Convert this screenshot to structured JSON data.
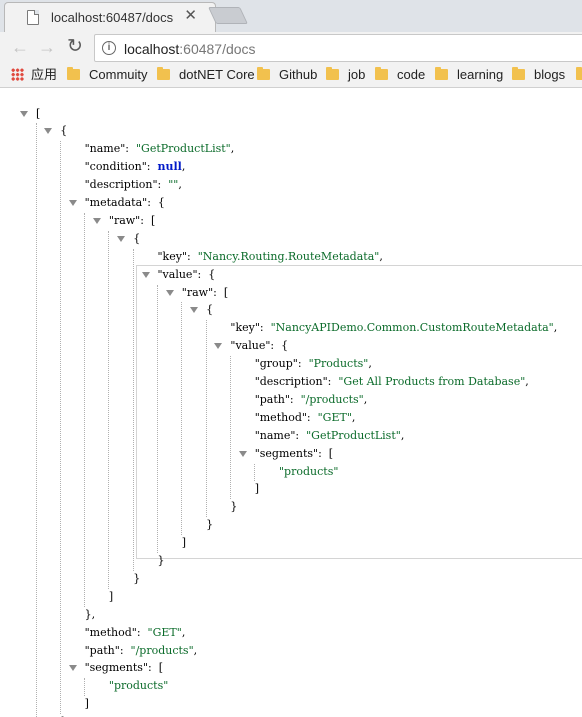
{
  "browser": {
    "tab_title": "localhost:60487/docs",
    "url_host": "localhost",
    "url_rest": ":60487/docs",
    "bookmarks": [
      "应用",
      "Commuity",
      "dotNET Core",
      "Github",
      "job",
      "code",
      "learning",
      "blogs"
    ]
  },
  "json_lines": [
    {
      "depth": 0,
      "arrow": true,
      "parts": [
        {
          "t": "[",
          "c": "p"
        }
      ]
    },
    {
      "depth": 1,
      "arrow": true,
      "parts": [
        {
          "t": "{",
          "c": "p"
        }
      ]
    },
    {
      "depth": 2,
      "parts": [
        {
          "t": "\"name\"",
          "c": "k"
        },
        {
          "t": ":  ",
          "c": "p"
        },
        {
          "t": "\"GetProductList\"",
          "c": "s"
        },
        {
          "t": ",",
          "c": "p"
        }
      ]
    },
    {
      "depth": 2,
      "parts": [
        {
          "t": "\"condition\"",
          "c": "k"
        },
        {
          "t": ":  ",
          "c": "p"
        },
        {
          "t": "null",
          "c": "n"
        },
        {
          "t": ",",
          "c": "p"
        }
      ]
    },
    {
      "depth": 2,
      "parts": [
        {
          "t": "\"description\"",
          "c": "k"
        },
        {
          "t": ":  ",
          "c": "p"
        },
        {
          "t": "\"\"",
          "c": "s"
        },
        {
          "t": ",",
          "c": "p"
        }
      ]
    },
    {
      "depth": 2,
      "arrow": true,
      "parts": [
        {
          "t": "\"metadata\"",
          "c": "k"
        },
        {
          "t": ":  {",
          "c": "p"
        }
      ]
    },
    {
      "depth": 3,
      "arrow": true,
      "parts": [
        {
          "t": "\"raw\"",
          "c": "k"
        },
        {
          "t": ":  [",
          "c": "p"
        }
      ]
    },
    {
      "depth": 4,
      "arrow": true,
      "parts": [
        {
          "t": "{",
          "c": "p"
        }
      ]
    },
    {
      "depth": 5,
      "parts": [
        {
          "t": "\"key\"",
          "c": "k"
        },
        {
          "t": ":  ",
          "c": "p"
        },
        {
          "t": "\"Nancy.Routing.RouteMetadata\"",
          "c": "s"
        },
        {
          "t": ",",
          "c": "p"
        }
      ]
    },
    {
      "depth": 5,
      "arrow": true,
      "parts": [
        {
          "t": "\"value\"",
          "c": "k"
        },
        {
          "t": ":  {",
          "c": "p"
        }
      ]
    },
    {
      "depth": 6,
      "arrow": true,
      "parts": [
        {
          "t": "\"raw\"",
          "c": "k"
        },
        {
          "t": ":  [",
          "c": "p"
        }
      ]
    },
    {
      "depth": 7,
      "arrow": true,
      "parts": [
        {
          "t": "{",
          "c": "p"
        }
      ]
    },
    {
      "depth": 8,
      "parts": [
        {
          "t": "\"key\"",
          "c": "k"
        },
        {
          "t": ":  ",
          "c": "p"
        },
        {
          "t": "\"NancyAPIDemo.Common.CustomRouteMetadata\"",
          "c": "s"
        },
        {
          "t": ",",
          "c": "p"
        }
      ]
    },
    {
      "depth": 8,
      "arrow": true,
      "parts": [
        {
          "t": "\"value\"",
          "c": "k"
        },
        {
          "t": ":  {",
          "c": "p"
        }
      ]
    },
    {
      "depth": 9,
      "parts": [
        {
          "t": "\"group\"",
          "c": "k"
        },
        {
          "t": ":  ",
          "c": "p"
        },
        {
          "t": "\"Products\"",
          "c": "s"
        },
        {
          "t": ",",
          "c": "p"
        }
      ]
    },
    {
      "depth": 9,
      "parts": [
        {
          "t": "\"description\"",
          "c": "k"
        },
        {
          "t": ":  ",
          "c": "p"
        },
        {
          "t": "\"Get All Products from Database\"",
          "c": "s"
        },
        {
          "t": ",",
          "c": "p"
        }
      ]
    },
    {
      "depth": 9,
      "parts": [
        {
          "t": "\"path\"",
          "c": "k"
        },
        {
          "t": ":  ",
          "c": "p"
        },
        {
          "t": "\"/products\"",
          "c": "s"
        },
        {
          "t": ",",
          "c": "p"
        }
      ]
    },
    {
      "depth": 9,
      "parts": [
        {
          "t": "\"method\"",
          "c": "k"
        },
        {
          "t": ":  ",
          "c": "p"
        },
        {
          "t": "\"GET\"",
          "c": "s"
        },
        {
          "t": ",",
          "c": "p"
        }
      ]
    },
    {
      "depth": 9,
      "parts": [
        {
          "t": "\"name\"",
          "c": "k"
        },
        {
          "t": ":  ",
          "c": "p"
        },
        {
          "t": "\"GetProductList\"",
          "c": "s"
        },
        {
          "t": ",",
          "c": "p"
        }
      ]
    },
    {
      "depth": 9,
      "arrow": true,
      "parts": [
        {
          "t": "\"segments\"",
          "c": "k"
        },
        {
          "t": ":  [",
          "c": "p"
        }
      ]
    },
    {
      "depth": 10,
      "parts": [
        {
          "t": "\"products\"",
          "c": "s"
        }
      ]
    },
    {
      "depth": 9,
      "parts": [
        {
          "t": "]",
          "c": "p"
        }
      ]
    },
    {
      "depth": 8,
      "parts": [
        {
          "t": "}",
          "c": "p"
        }
      ]
    },
    {
      "depth": 7,
      "parts": [
        {
          "t": "}",
          "c": "p"
        }
      ]
    },
    {
      "depth": 6,
      "parts": [
        {
          "t": "]",
          "c": "p"
        }
      ]
    },
    {
      "depth": 5,
      "parts": [
        {
          "t": "}",
          "c": "p"
        }
      ]
    },
    {
      "depth": 4,
      "parts": [
        {
          "t": "}",
          "c": "p"
        }
      ]
    },
    {
      "depth": 3,
      "parts": [
        {
          "t": "]",
          "c": "p"
        }
      ]
    },
    {
      "depth": 2,
      "parts": [
        {
          "t": "},",
          "c": "p"
        }
      ]
    },
    {
      "depth": 2,
      "parts": [
        {
          "t": "\"method\"",
          "c": "k"
        },
        {
          "t": ":  ",
          "c": "p"
        },
        {
          "t": "\"GET\"",
          "c": "s"
        },
        {
          "t": ",",
          "c": "p"
        }
      ]
    },
    {
      "depth": 2,
      "parts": [
        {
          "t": "\"path\"",
          "c": "k"
        },
        {
          "t": ":  ",
          "c": "p"
        },
        {
          "t": "\"/products\"",
          "c": "s"
        },
        {
          "t": ",",
          "c": "p"
        }
      ]
    },
    {
      "depth": 2,
      "arrow": true,
      "parts": [
        {
          "t": "\"segments\"",
          "c": "k"
        },
        {
          "t": ":  [",
          "c": "p"
        }
      ]
    },
    {
      "depth": 3,
      "parts": [
        {
          "t": "\"products\"",
          "c": "s"
        }
      ]
    },
    {
      "depth": 2,
      "parts": [
        {
          "t": "]",
          "c": "p"
        }
      ]
    },
    {
      "depth": 1,
      "parts": [
        {
          "t": "},",
          "c": "p"
        }
      ]
    },
    {
      "depth": 1,
      "arrow": true,
      "parts": [
        {
          "t": "{",
          "c": "p"
        }
      ]
    }
  ]
}
